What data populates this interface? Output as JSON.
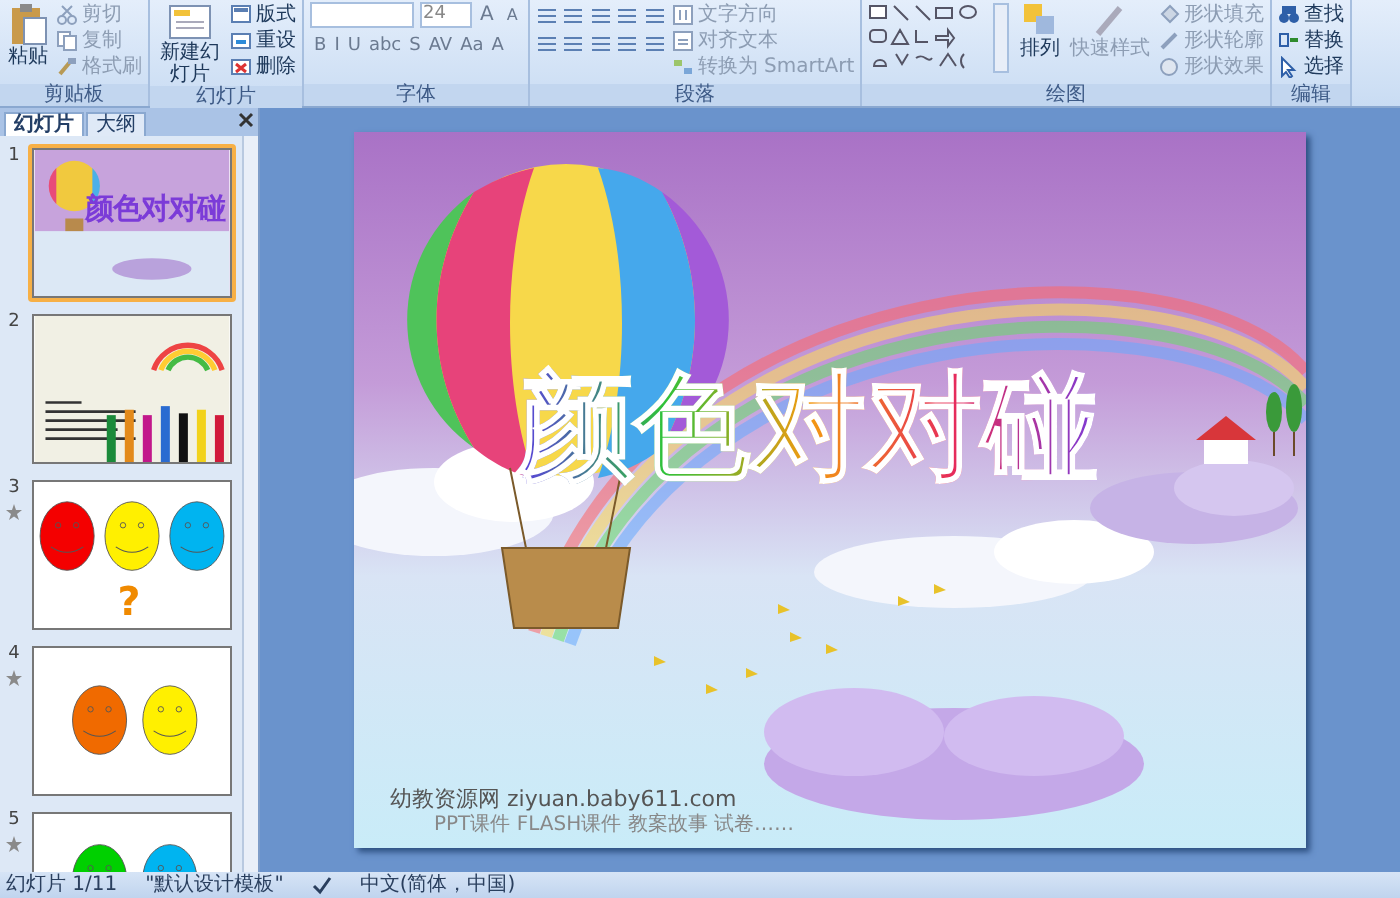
{
  "ribbon": {
    "groups": [
      {
        "kind": "clipboard",
        "label": "剪贴板",
        "big": "粘贴",
        "items": [
          {
            "label": "剪切",
            "disabled": true
          },
          {
            "label": "复制",
            "disabled": true
          },
          {
            "label": "格式刷",
            "disabled": true
          }
        ]
      },
      {
        "kind": "slides",
        "label": "幻灯片",
        "big": "新建幻灯片",
        "items": [
          {
            "label": "版式",
            "disabled": false
          },
          {
            "label": "重设",
            "disabled": false
          },
          {
            "label": "删除",
            "disabled": false
          }
        ]
      },
      {
        "kind": "font",
        "label": "字体",
        "font_size": "24",
        "size_buttons": [
          "A",
          "A"
        ],
        "format_buttons": [
          "B",
          "I",
          "U",
          "abc",
          "S",
          "AV",
          "Aa",
          "A"
        ]
      },
      {
        "kind": "paragraph",
        "label": "段落",
        "items": [
          {
            "label": "文字方向",
            "disabled": true
          },
          {
            "label": "对齐文本",
            "disabled": true
          },
          {
            "label": "转换为 SmartArt",
            "disabled": true
          }
        ]
      },
      {
        "kind": "drawing",
        "label": "绘图",
        "arrange": "排列",
        "quick_styles": {
          "label": "快速样式",
          "disabled": true
        },
        "items": [
          {
            "label": "形状填充",
            "disabled": true
          },
          {
            "label": "形状轮廓",
            "disabled": true
          },
          {
            "label": "形状效果",
            "disabled": true
          }
        ]
      },
      {
        "kind": "editing",
        "label": "编辑",
        "items": [
          {
            "label": "查找",
            "disabled": false
          },
          {
            "label": "替换",
            "disabled": false
          },
          {
            "label": "选择",
            "disabled": false
          }
        ]
      }
    ]
  },
  "pane": {
    "tabs": [
      {
        "label": "幻灯片",
        "selected": true
      },
      {
        "label": "大纲",
        "selected": false
      }
    ],
    "thumbnails": [
      {
        "number": "1",
        "kind": "title",
        "selected": true,
        "animated": false,
        "text": "颜色对对碰"
      },
      {
        "number": "2",
        "kind": "pencils",
        "selected": false,
        "animated": false
      },
      {
        "number": "3",
        "kind": "three-faces",
        "selected": false,
        "animated": true,
        "text": "?"
      },
      {
        "number": "4",
        "kind": "two-faces",
        "selected": false,
        "animated": true
      },
      {
        "number": "5",
        "kind": "faces-partial",
        "selected": false,
        "animated": true
      }
    ]
  },
  "slide": {
    "title": "颜色对对碰",
    "footer": "幼教资源网 ziyuan.baby611.com",
    "footer_note": "PPT课件  FLASH课件  教案故事  试卷……"
  },
  "status_bar": {
    "slide_counter": "幻灯片 1/11",
    "theme": "\"默认设计模板\"",
    "language": "中文(简体，中国)"
  }
}
